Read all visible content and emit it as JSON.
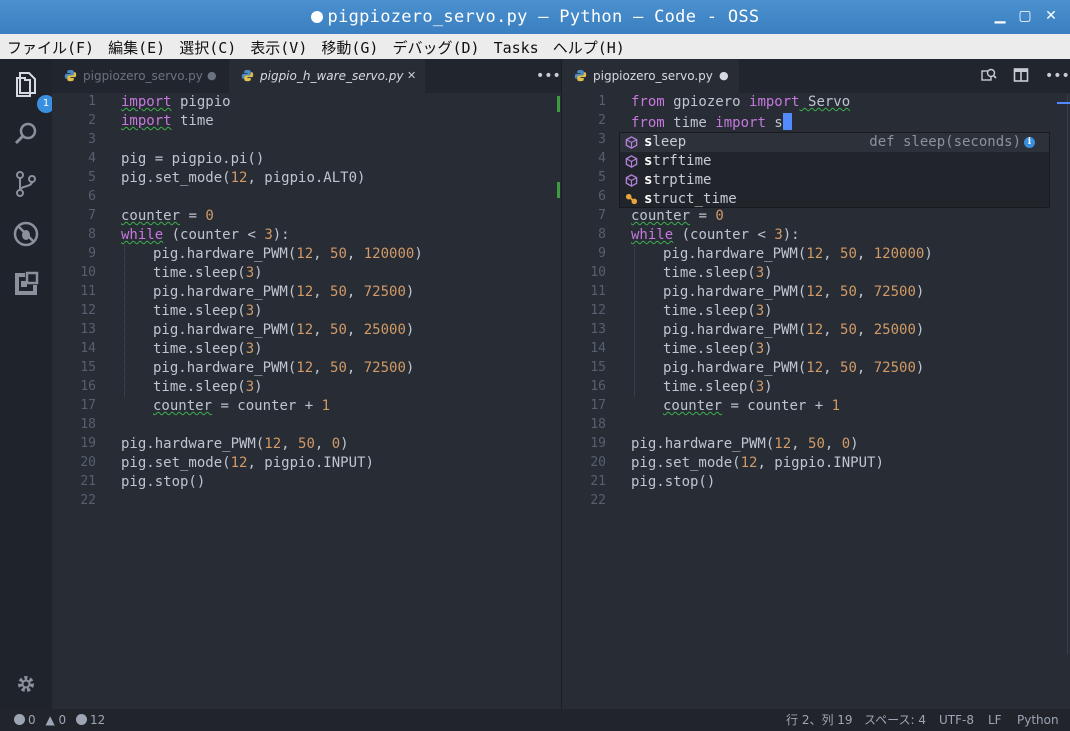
{
  "window": {
    "title": "pigpiozero_servo.py — Python — Code - OSS"
  },
  "menu": [
    "ファイル(F)",
    "編集(E)",
    "選択(C)",
    "表示(V)",
    "移動(G)",
    "デバッグ(D)",
    "Tasks",
    "ヘルプ(H)"
  ],
  "activity": {
    "explorer_badge": "1"
  },
  "left_group": {
    "tabs": [
      {
        "label": "pigpiozero_servo.py",
        "state": "dirty"
      },
      {
        "label": "pigpio_h_ware_servo.py",
        "state": "active"
      }
    ],
    "line_numbers": [
      "1",
      "2",
      "3",
      "4",
      "5",
      "6",
      "7",
      "8",
      "9",
      "10",
      "11",
      "12",
      "13",
      "14",
      "15",
      "16",
      "17",
      "18",
      "19",
      "20",
      "21",
      "22"
    ]
  },
  "right_group": {
    "tabs": [
      {
        "label": "pigpiozero_servo.py",
        "state": "active-dirty"
      }
    ],
    "line_numbers": [
      "1",
      "2",
      "3",
      "4",
      "5",
      "6",
      "7",
      "8",
      "9",
      "10",
      "11",
      "12",
      "13",
      "14",
      "15",
      "16",
      "17",
      "18",
      "19",
      "20",
      "21",
      "22"
    ]
  },
  "code_left": {
    "l1a": "import",
    "l1b": " pigpio",
    "l2a": "import",
    "l2b": " time",
    "l4": "pig = pigpio.pi()",
    "l5a": "pig.set_mode(",
    "l5b": "12",
    "l5c": ", pigpio.ALT0)",
    "l7a": "counter",
    "l7b": " = ",
    "l7c": "0",
    "l8a": "while",
    "l8b": " (counter < ",
    "l8c": "3",
    "l8d": "):",
    "pwm": "pig.hardware_PWM(",
    "sleep": "time.sleep(",
    "n12": "12",
    "n50": "50",
    "n3": "3",
    "v120000": "120000",
    "v72500": "72500",
    "v25000": "25000",
    "comma": ", ",
    "close": ")",
    "l17a": "counter",
    "l17b": " = counter + ",
    "l17c": "1",
    "l19a": "pig.hardware_PWM(",
    "l19b": "12",
    "l19c": ", ",
    "l19d": "50",
    "l19e": ", ",
    "l19f": "0",
    "l19g": ")",
    "l20a": "pig.set_mode(",
    "l20b": "12",
    "l20c": ", pigpio.INPUT)",
    "l21": "pig.stop()"
  },
  "code_right": {
    "l1a": "from",
    "l1b": " gpiozero ",
    "l1c": "import",
    "l1d": " Servo",
    "l2a": "from",
    "l2b": " time ",
    "l2c": "import",
    "l2d": " s"
  },
  "suggest": {
    "items": [
      {
        "bold": "s",
        "rest": "leep",
        "kind": "method"
      },
      {
        "bold": "s",
        "rest": "trftime",
        "kind": "method"
      },
      {
        "bold": "s",
        "rest": "trptime",
        "kind": "method"
      },
      {
        "bold": "s",
        "rest": "truct_time",
        "kind": "class"
      }
    ],
    "detail": "def sleep(seconds)"
  },
  "status": {
    "errors": "0",
    "warnings": "0",
    "info": "12",
    "position": "行 2、列 19",
    "spaces": "スペース: 4",
    "encoding": "UTF-8",
    "eol": "LF",
    "language": "Python"
  }
}
